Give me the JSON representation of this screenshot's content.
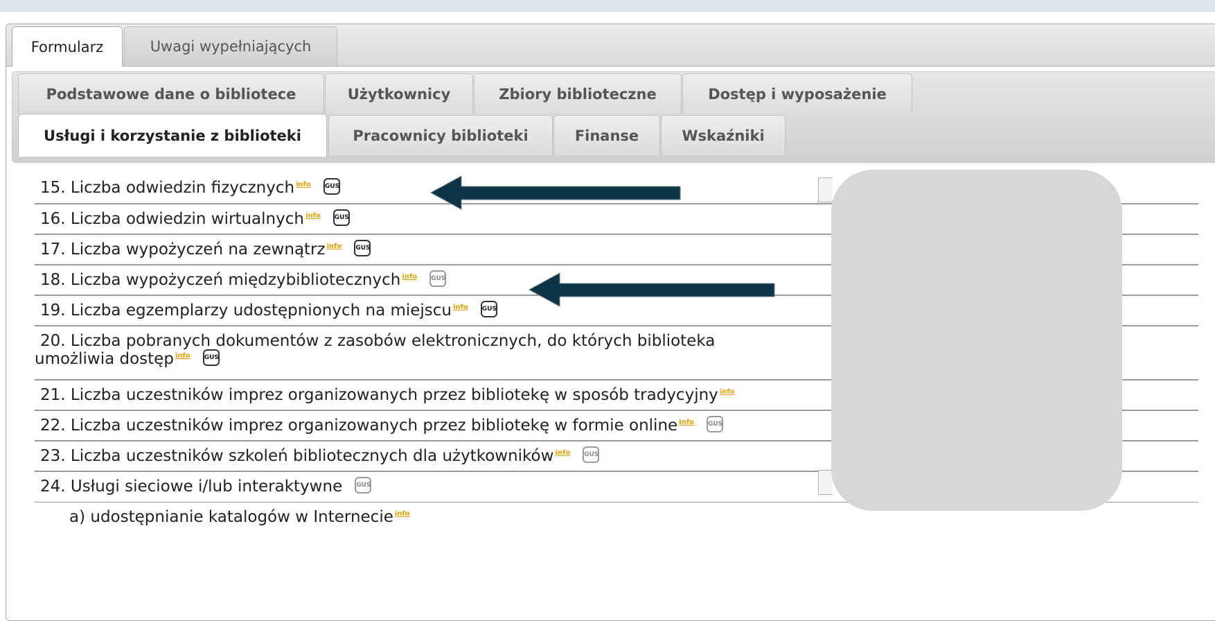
{
  "tabs_outer": [
    {
      "label": "Formularz",
      "active": true
    },
    {
      "label": "Uwagi wypełniających",
      "active": false
    }
  ],
  "tabs_inner_row1": [
    {
      "label": "Podstawowe dane o bibliotece"
    },
    {
      "label": "Użytkownicy"
    },
    {
      "label": "Zbiory biblioteczne"
    },
    {
      "label": "Dostęp i wyposażenie"
    }
  ],
  "tabs_inner_row2": [
    {
      "label": "Usługi i korzystanie z biblioteki",
      "active": true
    },
    {
      "label": "Pracownicy biblioteki"
    },
    {
      "label": "Finanse"
    },
    {
      "label": "Wskaźniki"
    }
  ],
  "info_label": "info",
  "badge_label": "GUS",
  "rows": [
    {
      "text": "15. Liczba odwiedzin fizycznych",
      "info": true,
      "badge": "dark"
    },
    {
      "text": "16. Liczba odwiedzin wirtualnych",
      "info": true,
      "badge": "dark"
    },
    {
      "text": "17. Liczba wypożyczeń na zewnątrz",
      "info": true,
      "badge": "dark"
    },
    {
      "text": "18. Liczba wypożyczeń międzybibliotecznych",
      "info": true,
      "badge": "light"
    },
    {
      "text": "19. Liczba egzemplarzy udostępnionych na miejscu",
      "info": true,
      "badge": "dark"
    },
    {
      "text": "20. Liczba pobranych dokumentów z zasobów elektronicznych, do których biblioteka",
      "text2": "umożliwia dostęp",
      "info": true,
      "badge": "dark"
    },
    {
      "text": "21. Liczba uczestników imprez organizowanych przez bibliotekę w sposób tradycyjny",
      "info": true,
      "badge": "none"
    },
    {
      "text": "22. Liczba uczestników imprez organizowanych przez bibliotekę w formie online",
      "info": true,
      "badge": "light"
    },
    {
      "text": "23. Liczba uczestników szkoleń bibliotecznych dla użytkowników",
      "info": true,
      "badge": "light"
    },
    {
      "text": "24. Usługi sieciowe i/lub interaktywne",
      "info": false,
      "badge": "light"
    },
    {
      "text": "a) udostępnianie katalogów w Internecie",
      "info": true,
      "badge": "none"
    }
  ],
  "colors": {
    "arrow": "#0d3447",
    "redaction_box": "#d7d7d7",
    "info": "#e8a100"
  }
}
